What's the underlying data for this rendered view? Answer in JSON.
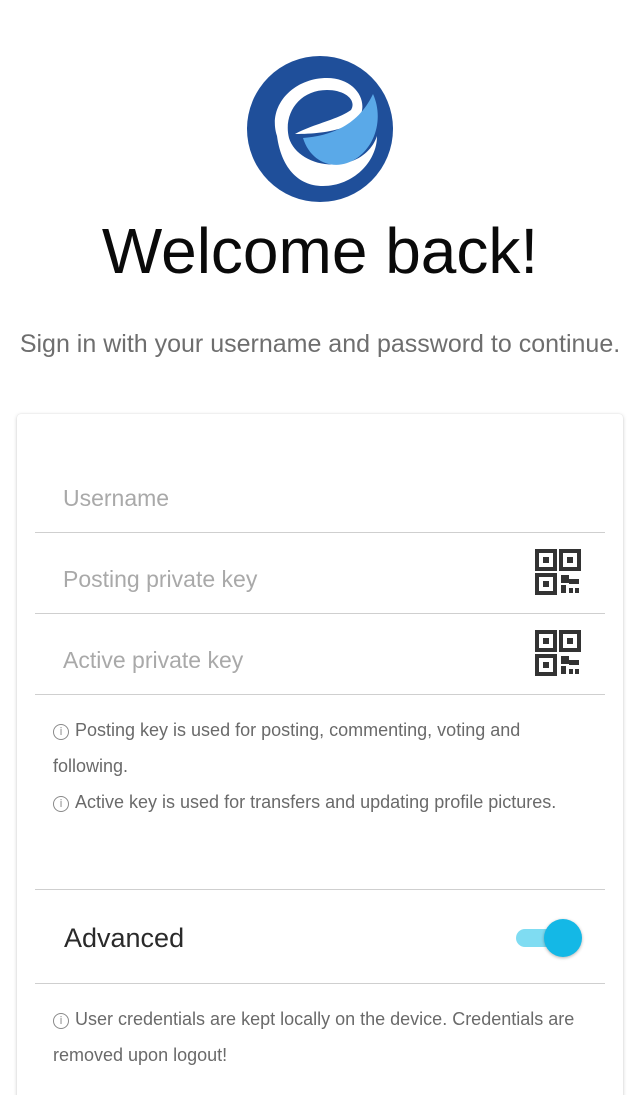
{
  "header": {
    "logo_icon": "ecency-logo-icon",
    "title": "Welcome back!",
    "subtitle": "Sign in with your username and password to continue."
  },
  "form": {
    "username_placeholder": "Username",
    "posting_key_placeholder": "Posting private key",
    "active_key_placeholder": "Active private key",
    "qr_icon": "qr-code-icon",
    "info_posting": "Posting key is used for posting, commenting, voting and following.",
    "info_active": "Active key is used for transfers and updating profile pictures.",
    "advanced_label": "Advanced",
    "advanced_enabled": true,
    "info_credentials": "User credentials are kept locally on the device. Credentials are removed upon logout!"
  },
  "colors": {
    "logo_dark": "#1f4f9a",
    "logo_light": "#5aa9e8",
    "toggle_thumb": "#14b8e6",
    "toggle_track": "#7fdcf2"
  }
}
